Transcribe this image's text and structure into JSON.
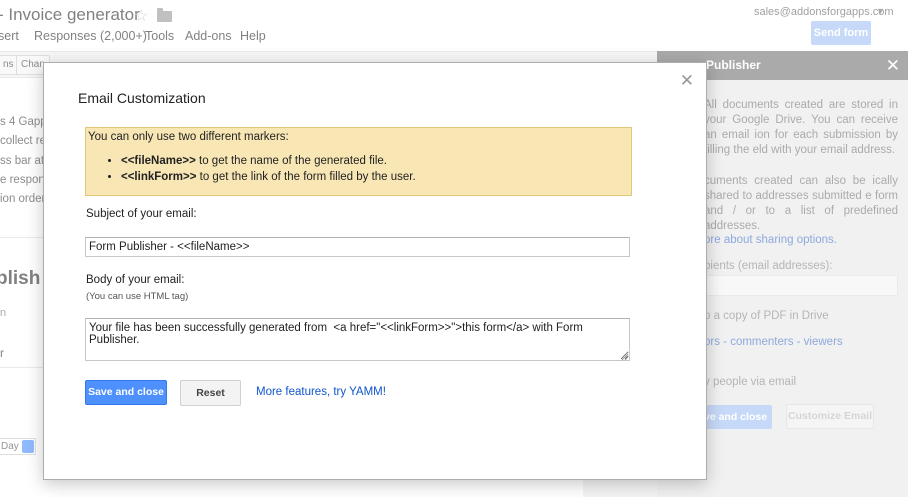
{
  "app": {
    "title": "- Invoice generator",
    "account": "sales@addonsforgapps.com",
    "send_form": "Send form"
  },
  "menu": [
    "sert",
    "Responses (2,000+)",
    "Tools",
    "Add-ons",
    "Help"
  ],
  "toolbar": {
    "btn1": "ns",
    "btn2": "Chan"
  },
  "background_left": {
    "lines": [
      "s 4 Gapps",
      "collect re",
      "ss bar at t",
      "e respon",
      "ion order"
    ],
    "heading": "blish",
    "small1": "n",
    "small2": "r",
    "day": "Day"
  },
  "sidebar": {
    "title": "Publisher",
    "para1": "All documents created are stored in your Google Drive. You can receive an email ion for each submission by filling the eld with your email address.",
    "para2": "cuments created can also be ically shared to addresses submitted e form and / or to a list of predefined addresses.",
    "sharing_link": "ore about sharing options.",
    "recipients_label": "pients (email addresses):",
    "pdf_label": "p a copy of PDF in Drive",
    "roles_link": "ors - commenters - viewers",
    "notify_label": "y people via email",
    "save_close": "ve and close",
    "customize_email": "Customize Email"
  },
  "modal": {
    "title": "Email Customization",
    "warning": {
      "intro": "You can only use two different markers:",
      "items": [
        {
          "marker": "<<fileName>>",
          "text": " to get the name of the generated file."
        },
        {
          "marker": "<<linkForm>>",
          "text": " to get the link of the form filled by the user."
        }
      ]
    },
    "subject_label": "Subject of your email:",
    "subject_value": "Form Publisher - <<fileName>>",
    "body_label": "Body of your email:",
    "body_hint": "(You can use HTML tag)",
    "body_value": "Your file has been successfully generated from  <a href=\"<<linkForm>>\">this form</a> with Form Publisher.",
    "save_close": "Save and close",
    "reset": "Reset",
    "more_features": "More features, try YAMM!"
  }
}
